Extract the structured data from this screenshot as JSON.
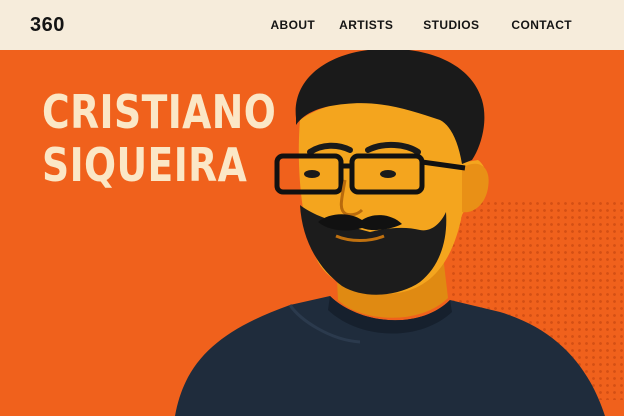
{
  "header": {
    "logo": "360",
    "nav": [
      {
        "label": "ABOUT"
      },
      {
        "label": "ARTISTS"
      },
      {
        "label": "STUDIOS"
      },
      {
        "label": "CONTACT"
      }
    ]
  },
  "hero": {
    "first_name": "CRISTIANO",
    "last_name": "SIQUEIRA",
    "portrait_icon": "artist-portrait-illustration"
  },
  "colors": {
    "header_bg": "#f6ecdb",
    "hero_bg": "#f0611c",
    "name_text": "#fbe7c6",
    "shirt": "#1f2c3c",
    "skin": "#f4a51e",
    "hair": "#1a1a1a"
  }
}
